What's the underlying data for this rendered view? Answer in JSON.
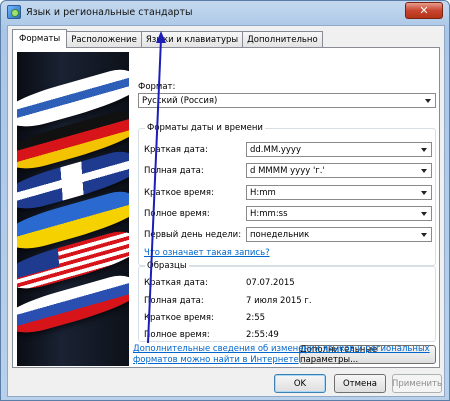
{
  "window": {
    "title": "Язык и региональные стандарты",
    "close_label": "✕"
  },
  "tabs": [
    {
      "label": "Форматы",
      "active": true
    },
    {
      "label": "Расположение",
      "active": false
    },
    {
      "label": "Языки и клавиатуры",
      "active": false
    },
    {
      "label": "Дополнительно",
      "active": false
    }
  ],
  "format": {
    "label": "Формат:",
    "value": "Русский (Россия)"
  },
  "datetime": {
    "group_title": "Форматы даты и времени",
    "short_date_label": "Краткая дата:",
    "short_date_value": "dd.MM.yyyy",
    "long_date_label": "Полная дата:",
    "long_date_value": "d MMMM yyyy 'г.'",
    "short_time_label": "Краткое время:",
    "short_time_value": "H:mm",
    "long_time_label": "Полное время:",
    "long_time_value": "H:mm:ss",
    "first_day_label": "Первый день недели:",
    "first_day_value": "понедельник",
    "help_link": "Что означает такая запись?"
  },
  "examples": {
    "group_title": "Образцы",
    "short_date_label": "Краткая дата:",
    "short_date_value": "07.07.2015",
    "long_date_label": "Полная дата:",
    "long_date_value": "7 июля 2015 г.",
    "short_time_label": "Краткое время:",
    "short_time_value": "2:55",
    "long_time_label": "Полное время:",
    "long_time_value": "2:55:49"
  },
  "additional_button": "Дополнительные параметры...",
  "info_link": "Дополнительные сведения об изменении языков и региональных форматов можно найти в Интернете",
  "footer": {
    "ok": "OK",
    "cancel": "Отмена",
    "apply": "Применить"
  },
  "colors": {
    "accent_link": "#0066cc",
    "annotation_arrow": "#1b1fb8"
  }
}
